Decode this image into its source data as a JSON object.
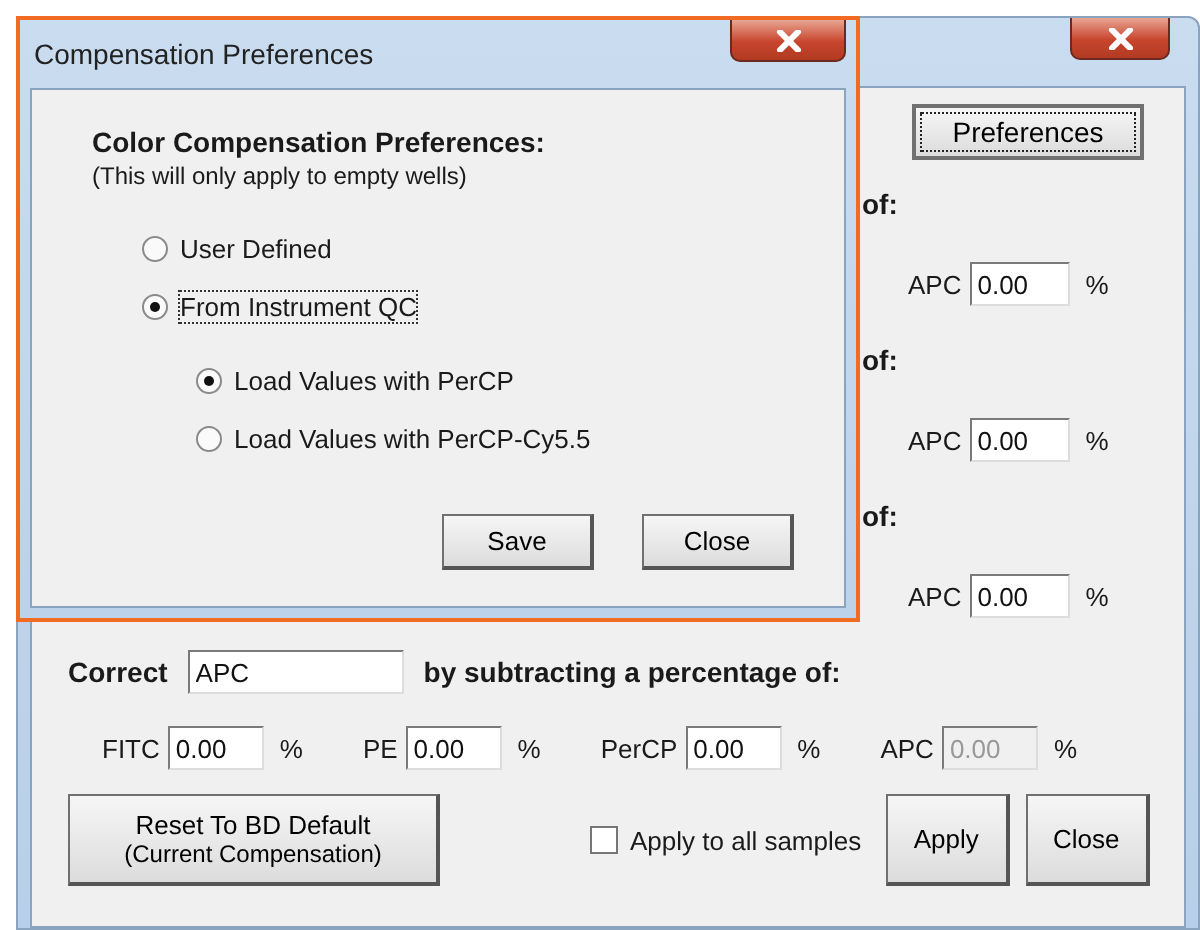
{
  "main_window": {
    "preferences_button": "Preferences",
    "hidden_groups": [
      {
        "heading_tail": "of:",
        "channel": "APC",
        "value": "0.00",
        "unit": "%"
      },
      {
        "heading_tail": "of:",
        "channel": "APC",
        "value": "0.00",
        "unit": "%"
      },
      {
        "heading_tail": "of:",
        "channel": "APC",
        "value": "0.00",
        "unit": "%"
      }
    ],
    "correct": {
      "label": "Correct",
      "value": "APC",
      "suffix": "by subtracting a percentage of:"
    },
    "channels": [
      {
        "name": "FITC",
        "value": "0.00",
        "unit": "%",
        "disabled": false
      },
      {
        "name": "PE",
        "value": "0.00",
        "unit": "%",
        "disabled": false
      },
      {
        "name": "PerCP",
        "value": "0.00",
        "unit": "%",
        "disabled": false
      },
      {
        "name": "APC",
        "value": "0.00",
        "unit": "%",
        "disabled": true
      }
    ],
    "reset_button": {
      "line_1": "Reset To BD Default",
      "line_2": "(Current Compensation)"
    },
    "apply_all": {
      "label": "Apply to all samples",
      "checked": false
    },
    "buttons": [
      "Apply",
      "Close"
    ]
  },
  "dialog": {
    "title": "Compensation Preferences",
    "heading": "Color Compensation Preferences:",
    "note": "(This will only apply to empty wells)",
    "options": [
      {
        "label": "User Defined",
        "selected": false,
        "focused": false
      },
      {
        "label": "From Instrument QC",
        "selected": true,
        "focused": true,
        "children": [
          {
            "label": "Load Values with PerCP",
            "selected": true
          },
          {
            "label": "Load Values with PerCP-Cy5.5",
            "selected": false
          }
        ]
      }
    ],
    "buttons": [
      "Save",
      "Close"
    ]
  }
}
